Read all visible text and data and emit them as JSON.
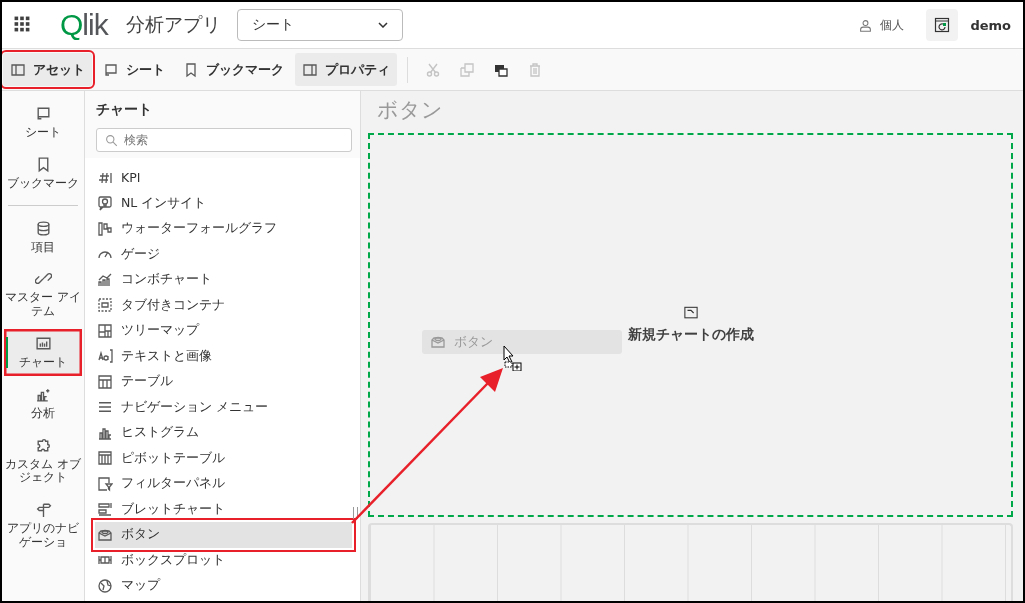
{
  "header": {
    "logo": "Qlik",
    "app_title": "分析アプリ",
    "view_select": {
      "value": "シート"
    },
    "space": "個人",
    "user": "demo"
  },
  "toolbar": {
    "buttons": [
      {
        "label": "アセット",
        "selected": true,
        "annotated": true
      },
      {
        "label": "シート",
        "selected": false,
        "annotated": false
      },
      {
        "label": "ブックマーク",
        "selected": false,
        "annotated": false
      },
      {
        "label": "プロパティ",
        "selected": true,
        "annotated": false
      }
    ],
    "actions": [
      {
        "kind": "cut",
        "disabled": true
      },
      {
        "kind": "copy",
        "disabled": true
      },
      {
        "kind": "duplicate",
        "disabled": false
      },
      {
        "kind": "delete",
        "disabled": true
      }
    ]
  },
  "rail": {
    "groups": [
      [
        {
          "label": "シート",
          "selected": false,
          "annotated": false
        },
        {
          "label": "ブックマーク",
          "selected": false,
          "annotated": false
        }
      ],
      [
        {
          "label": "項目",
          "selected": false,
          "annotated": false
        },
        {
          "label": "マスター アイテム",
          "selected": false,
          "annotated": false
        },
        {
          "label": "チャート",
          "selected": true,
          "annotated": true
        },
        {
          "label": "分析",
          "selected": false,
          "annotated": false
        },
        {
          "label": "カスタム オブジェクト",
          "selected": false,
          "annotated": false
        },
        {
          "label": "アプリのナビゲーショ",
          "selected": false,
          "annotated": false
        }
      ]
    ]
  },
  "panel": {
    "title": "チャート",
    "search": {
      "placeholder": "検索"
    },
    "items": [
      {
        "label": "KPI",
        "selected": false,
        "annotated": false
      },
      {
        "label": "NL インサイト",
        "selected": false,
        "annotated": false
      },
      {
        "label": "ウォーターフォールグラフ",
        "selected": false,
        "annotated": false
      },
      {
        "label": "ゲージ",
        "selected": false,
        "annotated": false
      },
      {
        "label": "コンボチャート",
        "selected": false,
        "annotated": false
      },
      {
        "label": "タブ付きコンテナ",
        "selected": false,
        "annotated": false
      },
      {
        "label": "ツリーマップ",
        "selected": false,
        "annotated": false
      },
      {
        "label": "テキストと画像",
        "selected": false,
        "annotated": false
      },
      {
        "label": "テーブル",
        "selected": false,
        "annotated": false
      },
      {
        "label": "ナビゲーション メニュー",
        "selected": false,
        "annotated": false
      },
      {
        "label": "ヒストグラム",
        "selected": false,
        "annotated": false
      },
      {
        "label": "ピボットテーブル",
        "selected": false,
        "annotated": false
      },
      {
        "label": "フィルターパネル",
        "selected": false,
        "annotated": false
      },
      {
        "label": "ブレットチャート",
        "selected": false,
        "annotated": false
      },
      {
        "label": "ボタン",
        "selected": true,
        "annotated": true
      },
      {
        "label": "ボックスプロット",
        "selected": false,
        "annotated": false
      },
      {
        "label": "マップ",
        "selected": false,
        "annotated": false
      }
    ]
  },
  "canvas": {
    "sheet_title": "ボタン",
    "drag_item": {
      "label": "ボタン"
    },
    "create_label": "新規チャートの作成"
  },
  "annotation_arrow": true
}
